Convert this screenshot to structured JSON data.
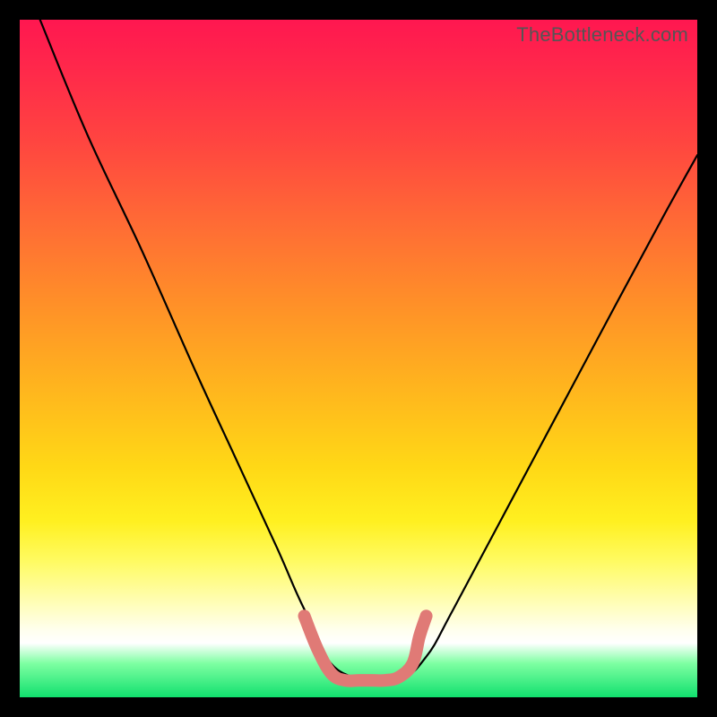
{
  "watermark": "TheBottleneck.com",
  "chart_data": {
    "type": "line",
    "title": "",
    "xlabel": "",
    "ylabel": "",
    "xlim": [
      0,
      100
    ],
    "ylim": [
      0,
      100
    ],
    "grid": false,
    "legend": false,
    "series": [
      {
        "name": "bottleneck-curve",
        "color": "#000000",
        "x": [
          3,
          10,
          18,
          26,
          32,
          38,
          42,
          47,
          56,
          60,
          64,
          72,
          80,
          88,
          95,
          100
        ],
        "values": [
          100,
          83,
          66,
          48,
          35,
          22,
          13,
          4,
          3,
          6,
          13,
          28,
          43,
          58,
          71,
          80
        ]
      },
      {
        "name": "optimal-zone-marker",
        "color": "#e07a76",
        "x": [
          42,
          44,
          46,
          48,
          50,
          52,
          54,
          56,
          58,
          59,
          60
        ],
        "values": [
          12,
          7,
          3.5,
          2.5,
          2.5,
          2.5,
          2.5,
          3,
          5,
          9,
          12
        ]
      }
    ],
    "annotations": []
  }
}
